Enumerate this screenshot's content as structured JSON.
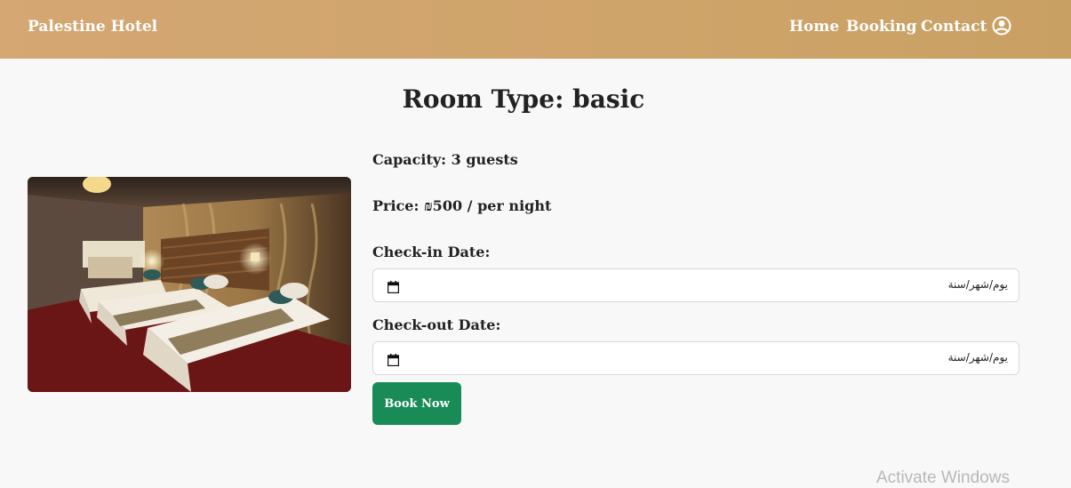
{
  "navbar": {
    "brand": "Palestine Hotel",
    "links": [
      "Home",
      "Booking",
      "Contact"
    ],
    "user_icon": "user-circle-icon",
    "background_color": "#cfa46a"
  },
  "room": {
    "title": "Room Type: basic",
    "capacity_label": "Capacity:",
    "capacity_value": "3 guests",
    "price_label": "Price:",
    "price_value": "₪500 / per night"
  },
  "form": {
    "checkin_label": "Check-in Date:",
    "checkin_value": "يوم/شهر/سنة",
    "checkout_label": "Check-out Date:",
    "checkout_value": "يوم/شهر/سنة",
    "calendar_icon": "calendar-icon",
    "submit_label": "Book Now",
    "submit_color": "#188b57"
  },
  "overlay": {
    "watermark": "Activate Windows"
  }
}
